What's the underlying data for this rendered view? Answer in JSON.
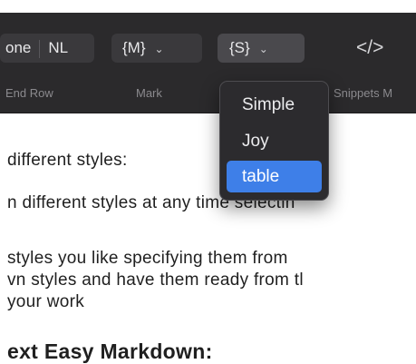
{
  "toolbar": {
    "line_mode": {
      "option_left": "one",
      "option_right": "NL",
      "caption": "End Row"
    },
    "mark": {
      "value": "{M}",
      "chevron": "⌄",
      "caption": "Mark"
    },
    "snippets": {
      "value": "{S}",
      "chevron": "⌄",
      "caption": "Snippets M"
    },
    "code_icon": "</>"
  },
  "dropdown": {
    "items": [
      "Simple",
      "Joy",
      "table"
    ],
    "selected": "table"
  },
  "document": {
    "lines": [
      "different styles:",
      "n different styles at any time selectin",
      "styles you like specifying them from",
      "vn styles and have them ready from tl",
      "your work"
    ],
    "heading": "ext Easy Markdown:"
  },
  "colors": {
    "toolbar_bg": "#2b2a2c",
    "menu_bg": "#2c2b2e",
    "selection_accent": "#3e7fe8"
  }
}
